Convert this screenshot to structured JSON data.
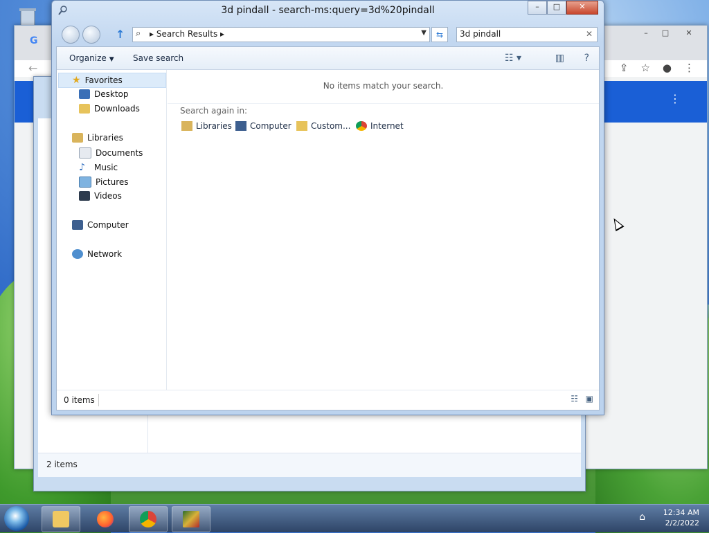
{
  "window": {
    "title": "3d pindall - search-ms:query=3d%20pindall",
    "breadcrumb": "Search Results",
    "search_value": "3d pindall",
    "caption": {
      "minimize": "–",
      "maximize": "□",
      "close": "✕"
    }
  },
  "command_bar": {
    "organize": "Organize",
    "save_search": "Save search"
  },
  "nav": {
    "favorites": "Favorites",
    "desktop": "Desktop",
    "downloads": "Downloads",
    "libraries": "Libraries",
    "documents": "Documents",
    "music": "Music",
    "pictures": "Pictures",
    "videos": "Videos",
    "computer": "Computer",
    "network": "Network"
  },
  "main": {
    "empty_message": "No items match your search.",
    "search_again_label": "Search again in:",
    "locations": [
      "Libraries",
      "Computer",
      "Custom...",
      "Internet"
    ]
  },
  "status": {
    "count": "0 items"
  },
  "back_explorer": {
    "count": "2 items"
  },
  "taskbar": {
    "time": "12:34 AM",
    "date": "2/2/2022"
  },
  "colors": {
    "accent": "#1a5fd6",
    "selection": "#dcebfa"
  }
}
